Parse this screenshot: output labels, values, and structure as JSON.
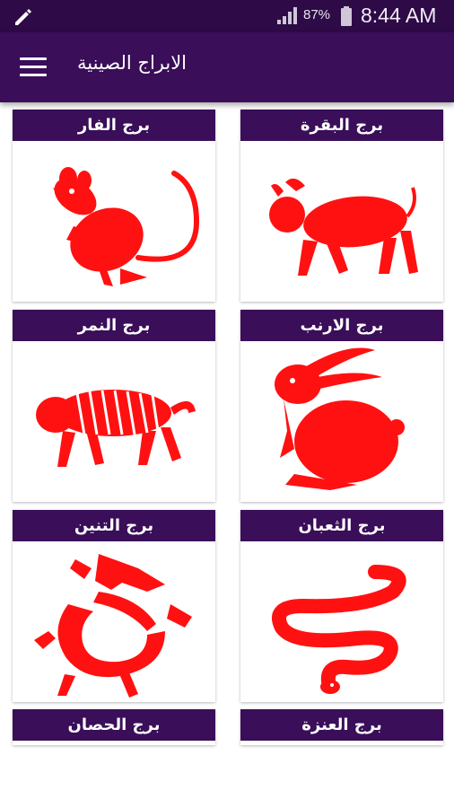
{
  "status_bar": {
    "battery_percent": "87%",
    "time": "8:44 AM"
  },
  "app_bar": {
    "title": "الابراج الصينية"
  },
  "zodiac": [
    {
      "label": "برج الفار",
      "icon": "rat-icon"
    },
    {
      "label": "برج البقرة",
      "icon": "ox-icon"
    },
    {
      "label": "برج النمر",
      "icon": "tiger-icon"
    },
    {
      "label": "برج الارنب",
      "icon": "rabbit-icon"
    },
    {
      "label": "برج التنين",
      "icon": "dragon-icon"
    },
    {
      "label": "برج الثعبان",
      "icon": "snake-icon"
    },
    {
      "label": "برج الحصان",
      "icon": "horse-icon"
    },
    {
      "label": "برج العنزة",
      "icon": "goat-icon"
    }
  ],
  "colors": {
    "primary": "#3a0e58",
    "status_bar": "#2e0a47",
    "icon_red": "#ff1111"
  }
}
